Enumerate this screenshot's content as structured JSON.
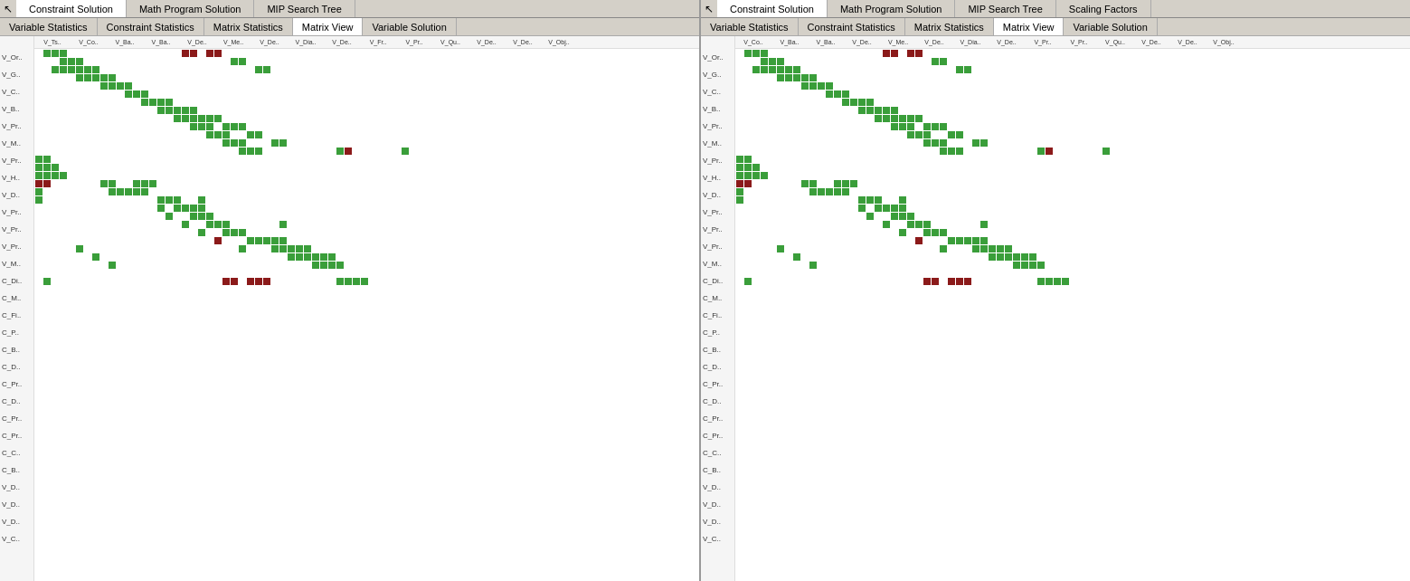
{
  "left_panel": {
    "top_tabs": [
      {
        "label": "Constraint Solution",
        "active": false
      },
      {
        "label": "Math Program Solution",
        "active": false
      },
      {
        "label": "MIP Search Tree",
        "active": false
      }
    ],
    "sub_tabs": [
      {
        "label": "Variable Statistics",
        "active": false
      },
      {
        "label": "Constraint Statistics",
        "active": false
      },
      {
        "label": "Matrix Statistics",
        "active": false
      },
      {
        "label": "Matrix View",
        "active": true
      },
      {
        "label": "Variable Solution",
        "active": false
      }
    ],
    "row_labels": [
      "V_Or..",
      "V_G..",
      "V_C..",
      "V_B..",
      "V_Pr..",
      "V_M..",
      "V_Pr..",
      "V_H..",
      "V_D..",
      "V_Pr..",
      "V_Pr..",
      "V_Pr..",
      "V_M..",
      "C_Di..",
      "C_M..",
      "C_Fi..",
      "C_P..",
      "C_B..",
      "C_D..",
      "C_Pr..",
      "C_D..",
      "C_Pr..",
      "C_Pr..",
      "C_C..",
      "C_B..",
      "V_D..",
      "V_D..",
      "V_D..",
      "V_C.."
    ],
    "col_labels": [
      "V_Ts..",
      "V_Co..",
      "V_Ba..",
      "V_Ba..",
      "V_De..",
      "V_Me..",
      "V_De..",
      "V_Dia..",
      "V_De..",
      "V_Fr..",
      "V_Pr..",
      "V_Qu..",
      "V_De..",
      "V_De..",
      "V_Obj.."
    ]
  },
  "right_panel": {
    "top_tabs": [
      {
        "label": "Constraint Solution",
        "active": false
      },
      {
        "label": "Math Program Solution",
        "active": false
      },
      {
        "label": "MIP Search Tree",
        "active": false
      },
      {
        "label": "Scaling Factors",
        "active": false
      }
    ],
    "sub_tabs": [
      {
        "label": "Variable Statistics",
        "active": false
      },
      {
        "label": "Constraint Statistics",
        "active": false
      },
      {
        "label": "Matrix Statistics",
        "active": false
      },
      {
        "label": "Matrix View",
        "active": true
      },
      {
        "label": "Variable Solution",
        "active": false
      }
    ],
    "row_labels": [
      "V_Or..",
      "V_G..",
      "V_C..",
      "V_B..",
      "V_Pr..",
      "V_M..",
      "V_Pr..",
      "V_H..",
      "V_D..",
      "V_Pr..",
      "V_Pr..",
      "V_Pr..",
      "V_M..",
      "C_Di..",
      "C_M..",
      "C_Fi..",
      "C_P..",
      "C_B..",
      "C_D..",
      "C_Pr..",
      "C_D..",
      "C_Pr..",
      "C_Pr..",
      "C_C..",
      "C_B..",
      "V_D..",
      "V_D..",
      "V_D..",
      "V_C.."
    ],
    "col_labels": [
      "V_Co..",
      "V_Ba..",
      "V_Ba..",
      "V_De..",
      "V_Me..",
      "V_De..",
      "V_Dia..",
      "V_De..",
      "V_Pr..",
      "V_Pr..",
      "V_Qu..",
      "V_De..",
      "V_De..",
      "V_Obj.."
    ]
  },
  "colors": {
    "green": "#3a9e3a",
    "dark_red": "#8b0000",
    "light_green": "#5cb85c",
    "bg": "#ffffff",
    "tab_bg": "#d4d0c8",
    "tab_active": "#ffffff"
  }
}
